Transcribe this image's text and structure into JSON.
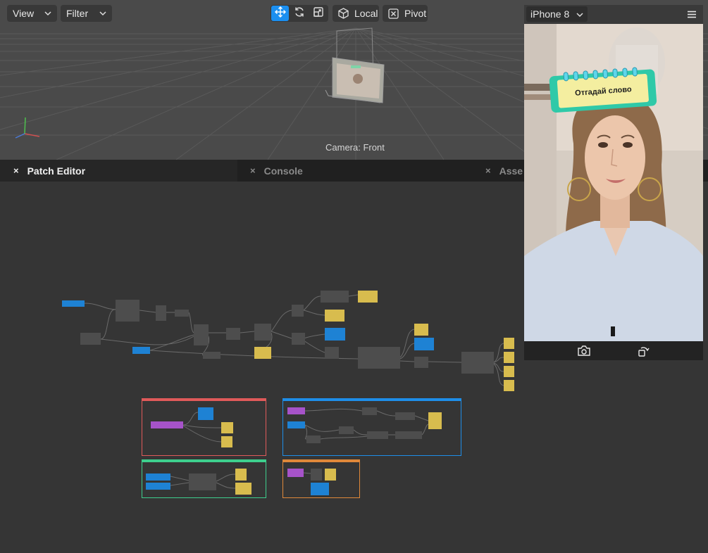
{
  "toolbar": {
    "view_label": "View",
    "filter_label": "Filter",
    "local_label": "Local",
    "pivot_label": "Pivot"
  },
  "viewport": {
    "camera_label": "Camera: Front"
  },
  "tabs": [
    {
      "label": "Patch Editor",
      "close": "×",
      "active": true
    },
    {
      "label": "Console",
      "close": "×",
      "active": false
    },
    {
      "label": "Asse",
      "close": "×",
      "active": false
    }
  ],
  "simulator": {
    "device_label": "iPhone 8",
    "overlay_text": "Отгадай слово"
  },
  "colors": {
    "accent_blue": "#1b8ff0",
    "node_blue": "#1e82d4",
    "node_yellow": "#d8bc4e",
    "node_purple": "#a653c9",
    "node_gray": "#4d4d4d",
    "group_red": "#e05a5a",
    "group_blue": "#1e8ee8",
    "group_green": "#3ecf8e",
    "group_orange": "#e0883a"
  },
  "icons": [
    "chevron-down-icon",
    "move-icon",
    "rotate-icon",
    "scale-icon",
    "cube-icon",
    "pivot-icon",
    "hamburger-menu-icon",
    "camera-flip-icon",
    "rotate-device-icon",
    "axis-gizmo-icon",
    "close-icon"
  ]
}
